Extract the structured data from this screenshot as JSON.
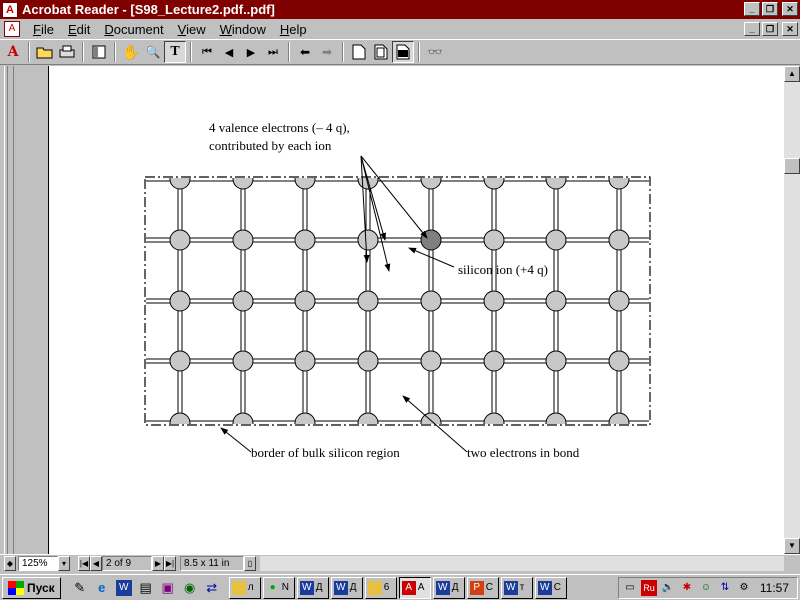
{
  "window": {
    "title": "Acrobat Reader - [S98_Lecture2.pdf..pdf]",
    "app_icon": "acrobat-icon",
    "minimize": "minimize-icon",
    "maximize": "restore-icon",
    "close": "close-icon"
  },
  "menu": {
    "items": [
      {
        "label": "File",
        "key": "F",
        "rest": "ile"
      },
      {
        "label": "Edit",
        "key": "E",
        "rest": "dit"
      },
      {
        "label": "Document",
        "key": "D",
        "rest": "ocument"
      },
      {
        "label": "View",
        "key": "V",
        "rest": "iew"
      },
      {
        "label": "Window",
        "key": "W",
        "rest": "indow"
      },
      {
        "label": "Help",
        "key": "H",
        "rest": "elp"
      }
    ]
  },
  "toolbar": {
    "icons": [
      "acrobat-logo-icon",
      "open-icon",
      "print-icon",
      "thumbnails-icon",
      "hand-icon",
      "zoom-icon",
      "text-select-icon",
      "first-page-icon",
      "prev-page-icon",
      "next-page-icon",
      "last-page-icon",
      "go-back-icon",
      "go-forward-icon",
      "actual-size-icon",
      "fit-page-icon",
      "fit-width-icon",
      "find-icon"
    ],
    "glyphs": {
      "acrobat": "A",
      "hand": "✋",
      "zoom": "🔍",
      "text": "T",
      "first": "⏮",
      "prev": "◀",
      "next": "▶",
      "last": "⏭",
      "back": "⬅",
      "forward": "➡",
      "find": "👓"
    }
  },
  "figure": {
    "label_valence_line1": "4 valence electrons (– 4 q),",
    "label_valence_line2": "contributed by each ion",
    "label_ion": "silicon ion (+4 q)",
    "label_border": "border of bulk silicon region",
    "label_bond": "two electrons in bond",
    "ion_color": "#c8c8c8",
    "highlight_color": "#808080"
  },
  "status": {
    "zoom": "125%",
    "page": "2 of 9",
    "page_size": "8.5 x 11 in"
  },
  "taskbar": {
    "start_label": "Пуск",
    "clock": "11:57",
    "tray_lang": "Ru",
    "tasks": [
      {
        "short": "л"
      },
      {
        "short": "N"
      },
      {
        "short": "Д"
      },
      {
        "short": "Д"
      },
      {
        "short": "6"
      },
      {
        "short": "A"
      },
      {
        "short": "Д"
      },
      {
        "short": "С"
      },
      {
        "short": "т"
      },
      {
        "short": "С"
      }
    ]
  }
}
